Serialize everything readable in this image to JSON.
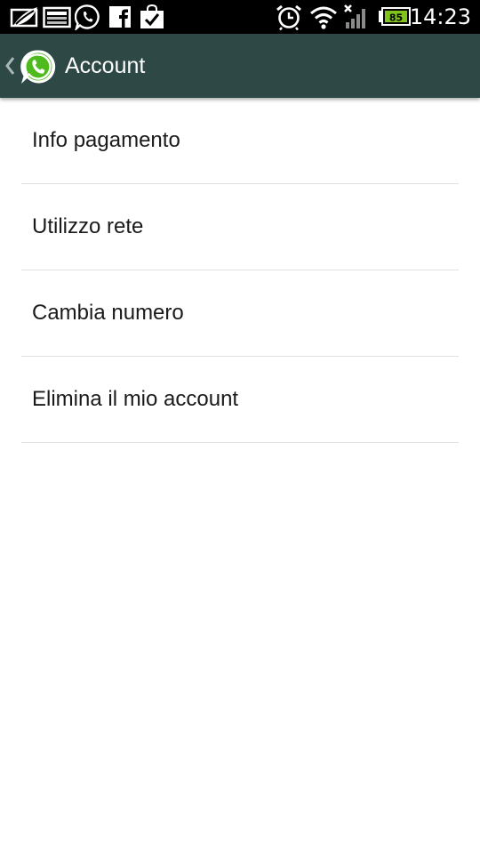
{
  "status_bar": {
    "time": "14:23",
    "battery_level": "85",
    "icons": [
      "eco-leaf-icon",
      "mail-envelope-icon",
      "whatsapp-notification-icon",
      "facebook-icon",
      "checklist-bag-icon",
      "alarm-clock-icon",
      "wifi-icon",
      "signal-no-service-icon",
      "battery-charging-icon"
    ],
    "battery_color": "#7fc31c"
  },
  "action_bar": {
    "title": "Account",
    "icon": "whatsapp-logo-icon",
    "background": "#2d4845"
  },
  "settings": {
    "items": [
      {
        "label": "Info pagamento"
      },
      {
        "label": "Utilizzo rete"
      },
      {
        "label": "Cambia numero"
      },
      {
        "label": "Elimina il mio account"
      }
    ]
  }
}
